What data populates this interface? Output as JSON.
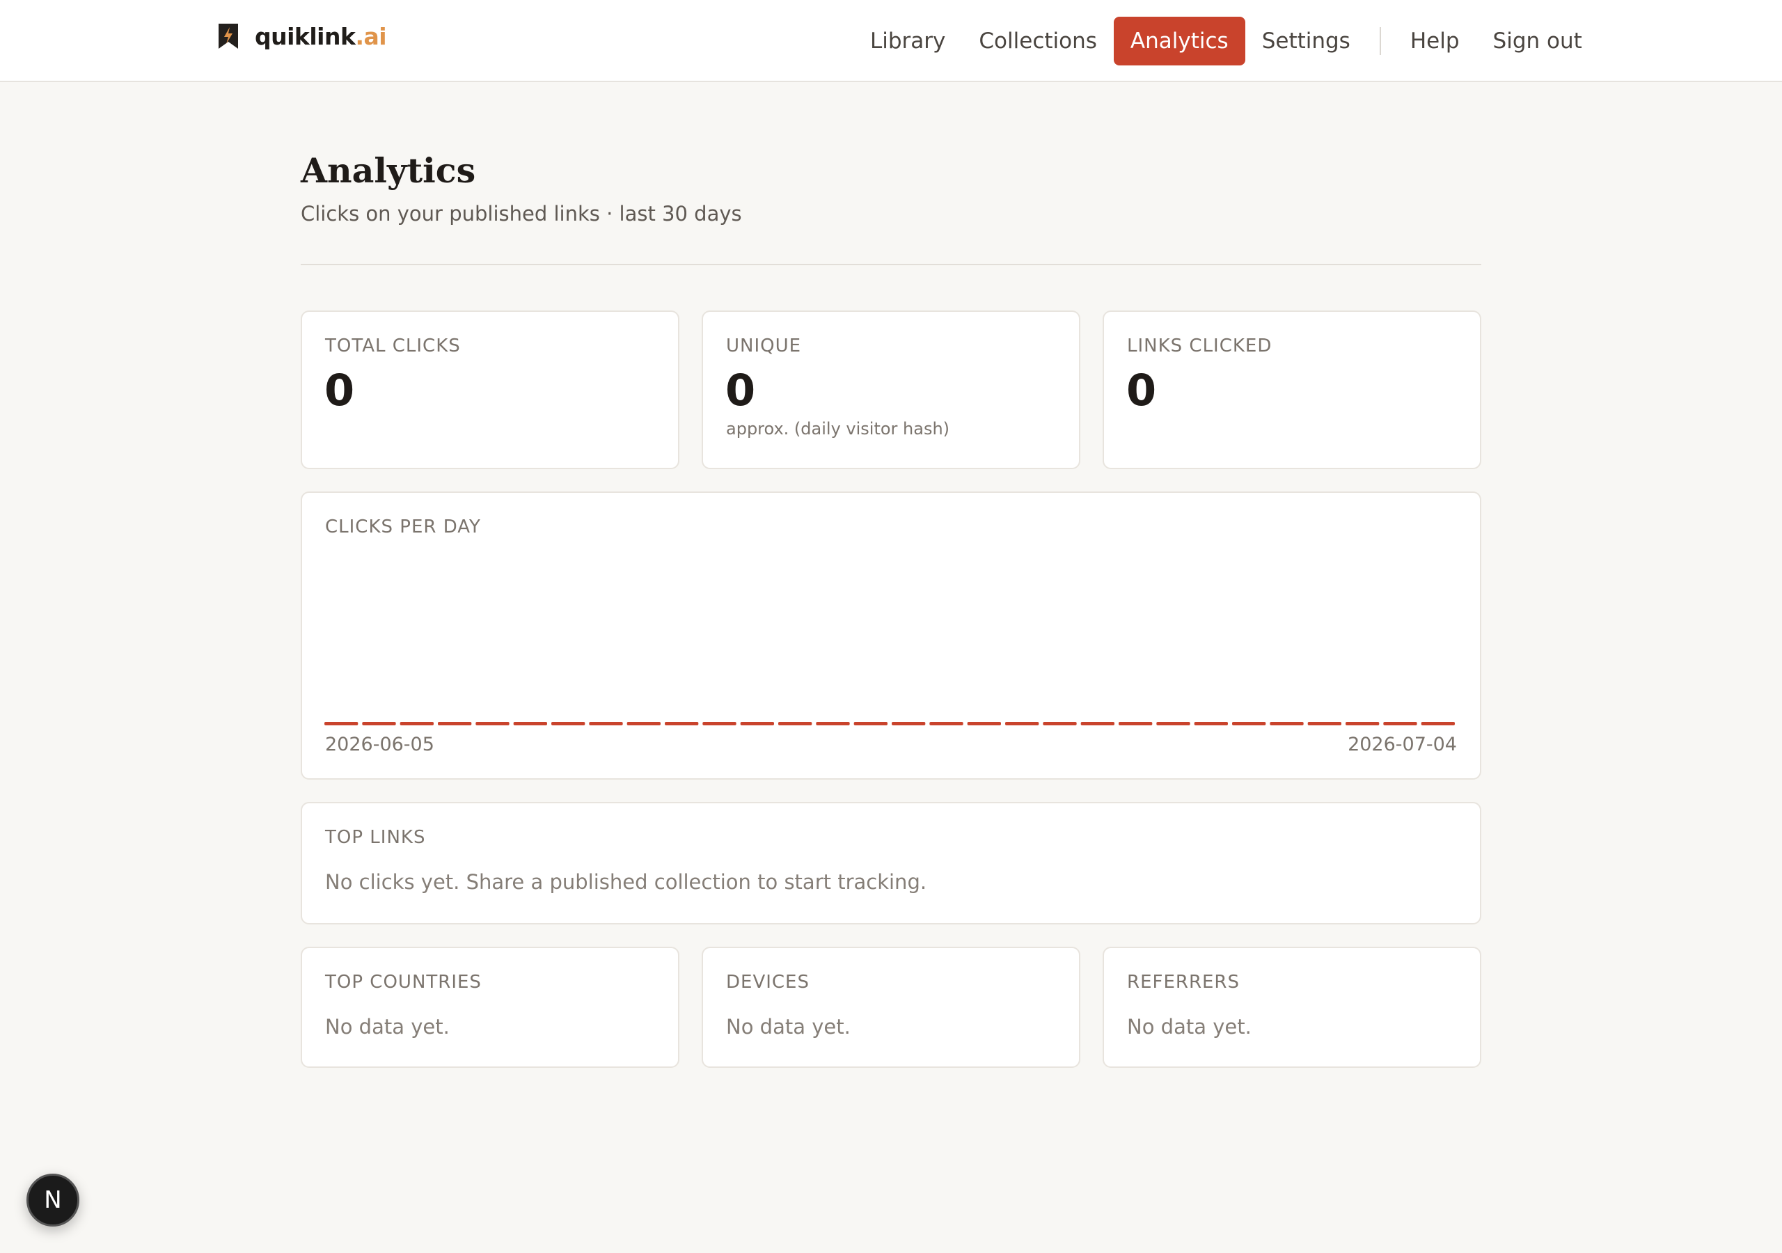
{
  "brand": {
    "name": "quiklink",
    "tld": ".ai"
  },
  "nav": {
    "items": [
      {
        "label": "Library"
      },
      {
        "label": "Collections"
      },
      {
        "label": "Analytics"
      },
      {
        "label": "Settings"
      },
      {
        "label": "Help"
      },
      {
        "label": "Sign out"
      }
    ],
    "active": "Analytics"
  },
  "page": {
    "title": "Analytics",
    "subtitle": "Clicks on your published links · last 30 days"
  },
  "stats": {
    "total_clicks": {
      "label": "TOTAL CLICKS",
      "value": "0"
    },
    "unique": {
      "label": "UNIQUE",
      "value": "0",
      "note": "approx. (daily visitor hash)"
    },
    "links_clicked": {
      "label": "LINKS CLICKED",
      "value": "0"
    }
  },
  "clicks_per_day": {
    "label": "CLICKS PER DAY",
    "start_label": "2026-06-05",
    "end_label": "2026-07-04"
  },
  "chart_data": {
    "type": "bar",
    "title": "CLICKS PER DAY",
    "xlabel": "",
    "ylabel": "",
    "x_range": [
      "2026-06-05",
      "2026-07-04"
    ],
    "values": [
      0,
      0,
      0,
      0,
      0,
      0,
      0,
      0,
      0,
      0,
      0,
      0,
      0,
      0,
      0,
      0,
      0,
      0,
      0,
      0,
      0,
      0,
      0,
      0,
      0,
      0,
      0,
      0,
      0,
      0
    ],
    "bar_color": "#c9432c",
    "grid": false
  },
  "top_links": {
    "label": "TOP LINKS",
    "empty": "No clicks yet. Share a published collection to start tracking."
  },
  "top_countries": {
    "label": "TOP COUNTRIES",
    "empty": "No data yet."
  },
  "devices": {
    "label": "DEVICES",
    "empty": "No data yet."
  },
  "referrers": {
    "label": "REFERRERS",
    "empty": "No data yet."
  },
  "badge": {
    "letter": "N"
  },
  "colors": {
    "accent": "#c9432c",
    "brand_tld": "#e0944a",
    "background": "#f8f7f4"
  }
}
